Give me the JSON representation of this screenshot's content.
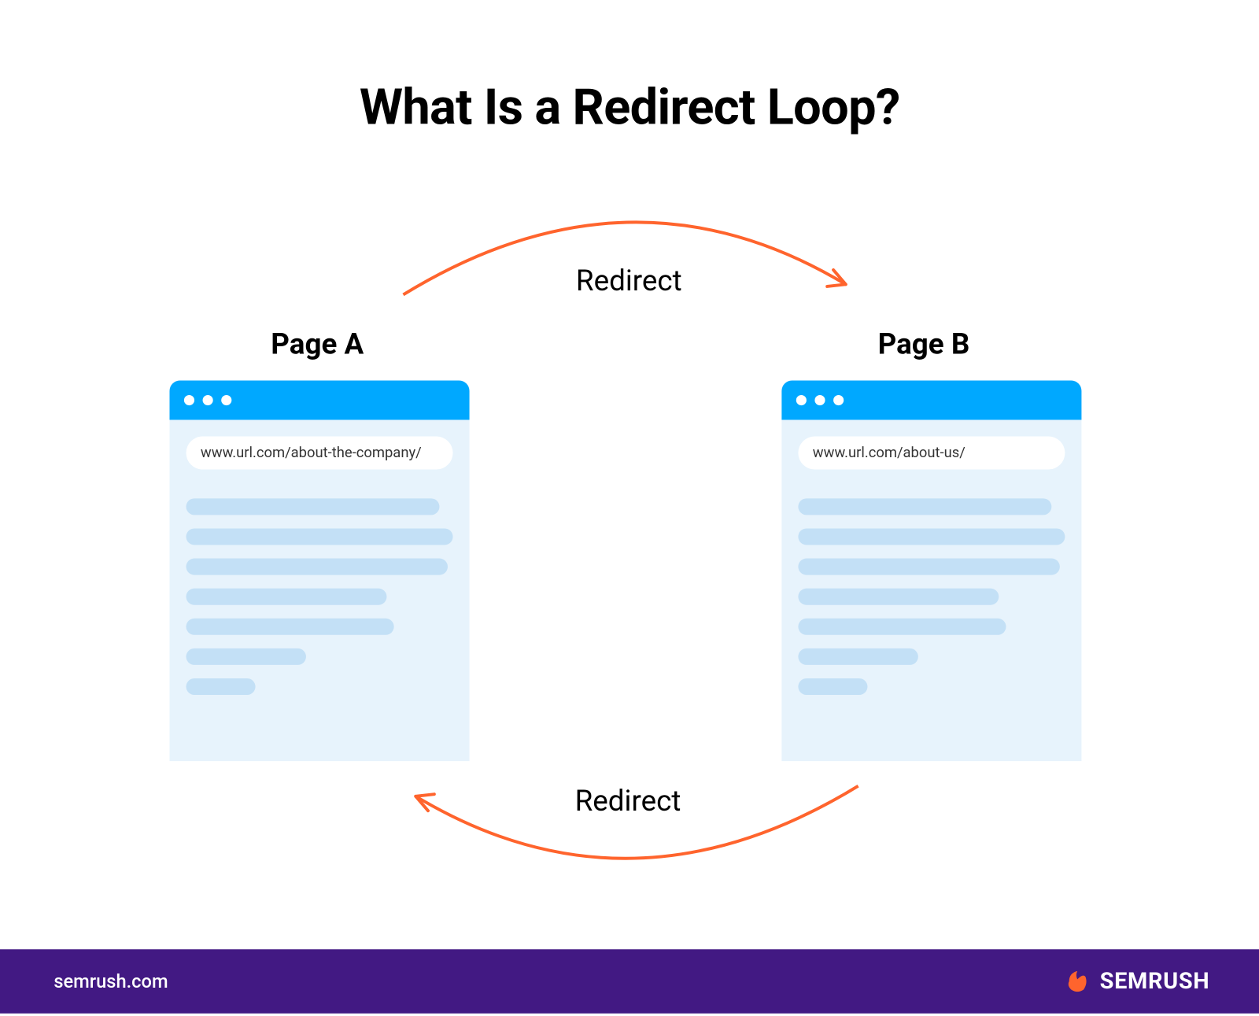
{
  "title": "What Is a Redirect Loop?",
  "page_a": {
    "label": "Page A",
    "url": "www.url.com/about-the-company/"
  },
  "page_b": {
    "label": "Page B",
    "url": "www.url.com/about-us/"
  },
  "redirect_label_top": "Redirect",
  "redirect_label_bottom": "Redirect",
  "footer": {
    "url": "semrush.com",
    "brand": "SEMRUSH"
  },
  "colors": {
    "arrow": "#ff642d",
    "browser_header": "#00a8ff",
    "browser_body": "#e7f3fc",
    "content_line": "#c3e0f6",
    "footer_bg": "#421983"
  }
}
